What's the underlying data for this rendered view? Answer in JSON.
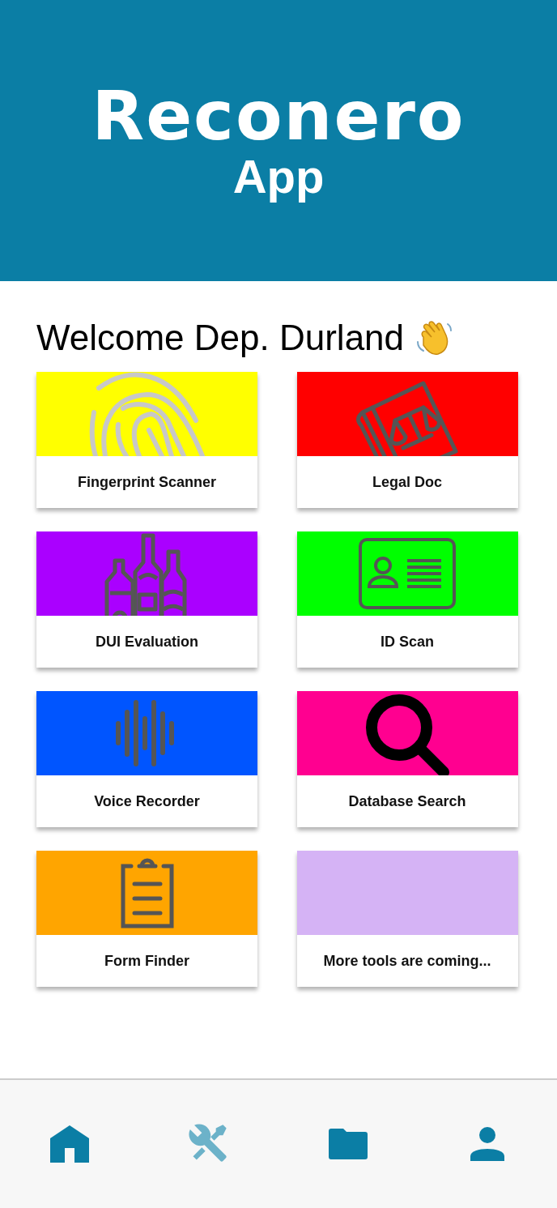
{
  "header": {
    "logo": "Reconero",
    "subtitle": "App"
  },
  "welcome": "Welcome Dep. Durland",
  "tiles": [
    {
      "label": "Fingerprint Scanner",
      "kind": "fingerprint",
      "color": "#ffff00"
    },
    {
      "label": "Legal Doc",
      "kind": "law-book",
      "color": "#ff0000"
    },
    {
      "label": "DUI Evaluation",
      "kind": "bottles",
      "color": "#aa00ff"
    },
    {
      "label": "ID Scan",
      "kind": "id-card",
      "color": "#00ff00"
    },
    {
      "label": "Voice Recorder",
      "kind": "soundwave",
      "color": "#0055ff"
    },
    {
      "label": "Database Search",
      "kind": "magnifier",
      "color": "#ff0090"
    },
    {
      "label": "Form Finder",
      "kind": "clipboard",
      "color": "#ffa500"
    },
    {
      "label": "More tools are coming...",
      "kind": "blank",
      "color": "#d5b3f5"
    }
  ],
  "nav": [
    {
      "kind": "home",
      "dimmed": false
    },
    {
      "kind": "tools",
      "dimmed": true
    },
    {
      "kind": "folder",
      "dimmed": false
    },
    {
      "kind": "profile",
      "dimmed": false
    }
  ]
}
